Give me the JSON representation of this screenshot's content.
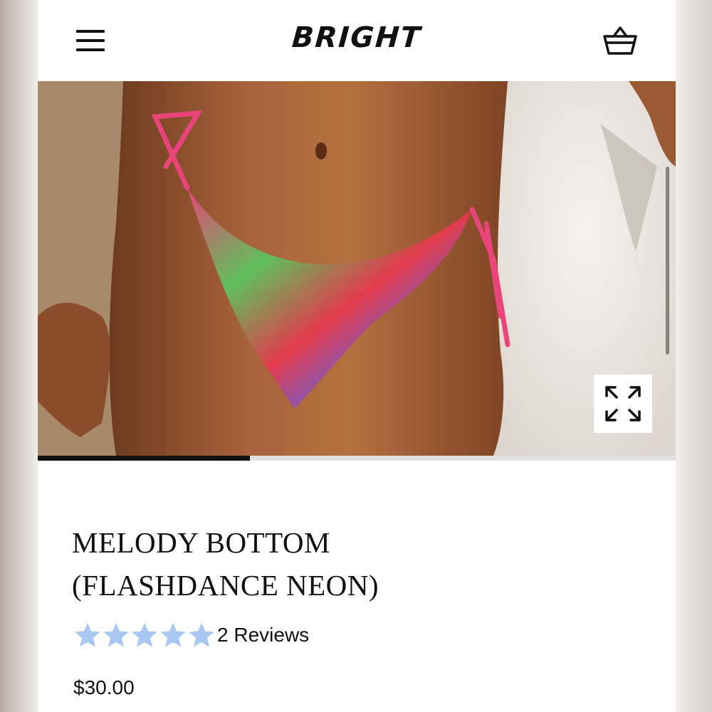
{
  "header": {
    "brand": "BRIGHT",
    "menu_icon": "hamburger-menu-icon",
    "cart_icon": "basket-icon"
  },
  "gallery": {
    "image_subject": "floral-print tie-side bikini bottom",
    "expand_icon": "expand-arrows-icon",
    "progress_fraction": 0.333
  },
  "product": {
    "title_line1": "MELODY BOTTOM",
    "title_line2": "(FLASHDANCE NEON)",
    "rating": 5,
    "rating_max": 5,
    "reviews_text": "2 Reviews",
    "price": "$30.00"
  },
  "colors": {
    "star": "#a9c8f2",
    "text": "#111111",
    "progress_track": "#e3e1df",
    "progress_fill": "#111111"
  }
}
